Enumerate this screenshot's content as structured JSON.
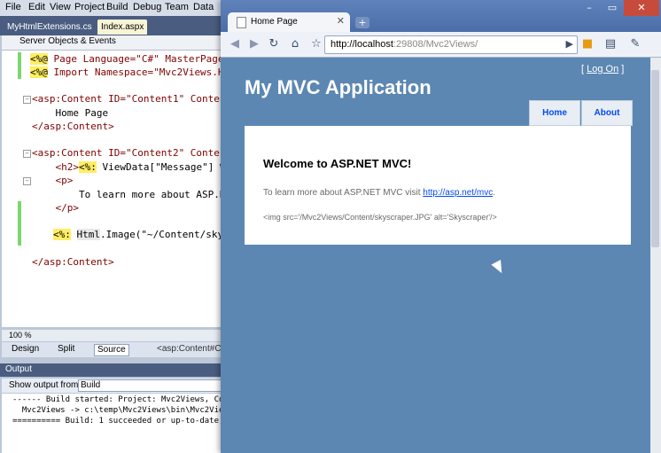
{
  "vs": {
    "menu": [
      "File",
      "Edit",
      "View",
      "Project",
      "Build",
      "Debug",
      "Team",
      "Data"
    ],
    "tabs": [
      "MyHtmlExtensions.cs",
      "Index.aspx"
    ],
    "objects_dropdown": "Server Objects & Events",
    "code": {
      "l1_a": "<%@",
      "l1_b": " Page Language=\"C#\" MasterPage",
      "l2_a": "<%@",
      "l2_b": " Import Namespace=\"Mvc2Views.H",
      "l3": "<asp:Content ID=\"Content1\" Conten",
      "l4": "    Home Page",
      "l5": "</asp:Content>",
      "l6": "<asp:Content ID=\"Content2\" Conter",
      "l7_a": "    <h2>",
      "l7_b": "<%:",
      "l7_c": " ViewData[\"Message\"] %",
      "l8": "    <p>",
      "l9": "        To learn more about ASP.N",
      "l10": "    </p>",
      "l11_a": "<%:",
      "l11_b": "Html",
      "l11_c": ".Image(\"~/Content/sky",
      "l12": "</asp:Content>"
    },
    "zoom": "100 %",
    "view_tabs": {
      "design": "Design",
      "split": "Split",
      "source": "Source",
      "crumb": "<asp:Content#Co"
    },
    "output": {
      "title": "Output",
      "show_from_label": "Show output from:",
      "show_from_value": "Build",
      "lines": [
        "------ Build started: Project: Mvc2Views, Conf",
        "  Mvc2Views -> c:\\temp\\Mvc2Views\\bin\\Mvc2Views",
        "========== Build: 1 succeeded or up-to-date, 0"
      ]
    }
  },
  "chrome": {
    "tab_title": "Home Page",
    "url_host": "http://localhost",
    "url_rest": ":29808/Mvc2Views/",
    "new_tab": "+",
    "window_controls": [
      "–",
      "▭",
      "✕"
    ],
    "icons": [
      "back-icon",
      "forward-icon",
      "reload-icon",
      "home-icon",
      "star-icon",
      "go-icon",
      "extension-icon",
      "page-menu-icon",
      "wrench-icon"
    ]
  },
  "site": {
    "login_prefix": "[ ",
    "login_link": "Log On",
    "login_suffix": " ]",
    "title": "My MVC Application",
    "menu": [
      "Home",
      "About"
    ],
    "heading": "Welcome to ASP.NET MVC!",
    "learn_more_prefix": "To learn more about ASP.NET MVC visit ",
    "learn_more_link": "http://asp.net/mvc",
    "learn_more_suffix": ".",
    "img_markup": "<img src='/Mvc2Views/Content/skyscraper.JPG' alt='Skyscraper'/>"
  },
  "colors": {
    "site_background": "#5c87b2",
    "menu_link": "#034af3",
    "chrome_frame": "#4a6ea8"
  }
}
